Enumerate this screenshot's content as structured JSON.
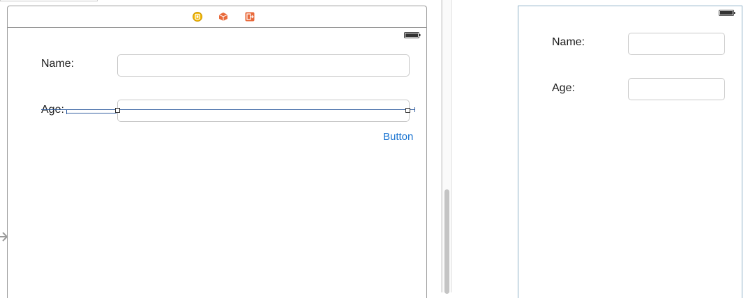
{
  "editor": {
    "dock_icons": [
      "view-controller-icon",
      "first-responder-icon",
      "exit-icon"
    ],
    "form": {
      "name_label": "Name:",
      "age_label": "Age:",
      "name_value": "",
      "age_value": "",
      "button_label": "Button"
    }
  },
  "preview": {
    "form": {
      "name_label": "Name:",
      "age_label": "Age:",
      "name_value": "",
      "age_value": ""
    }
  },
  "colors": {
    "button_blue": "#1a74d1",
    "constraint_blue": "#335fa0",
    "dock_yellow": "#f2b705",
    "dock_orange": "#e8693a"
  }
}
